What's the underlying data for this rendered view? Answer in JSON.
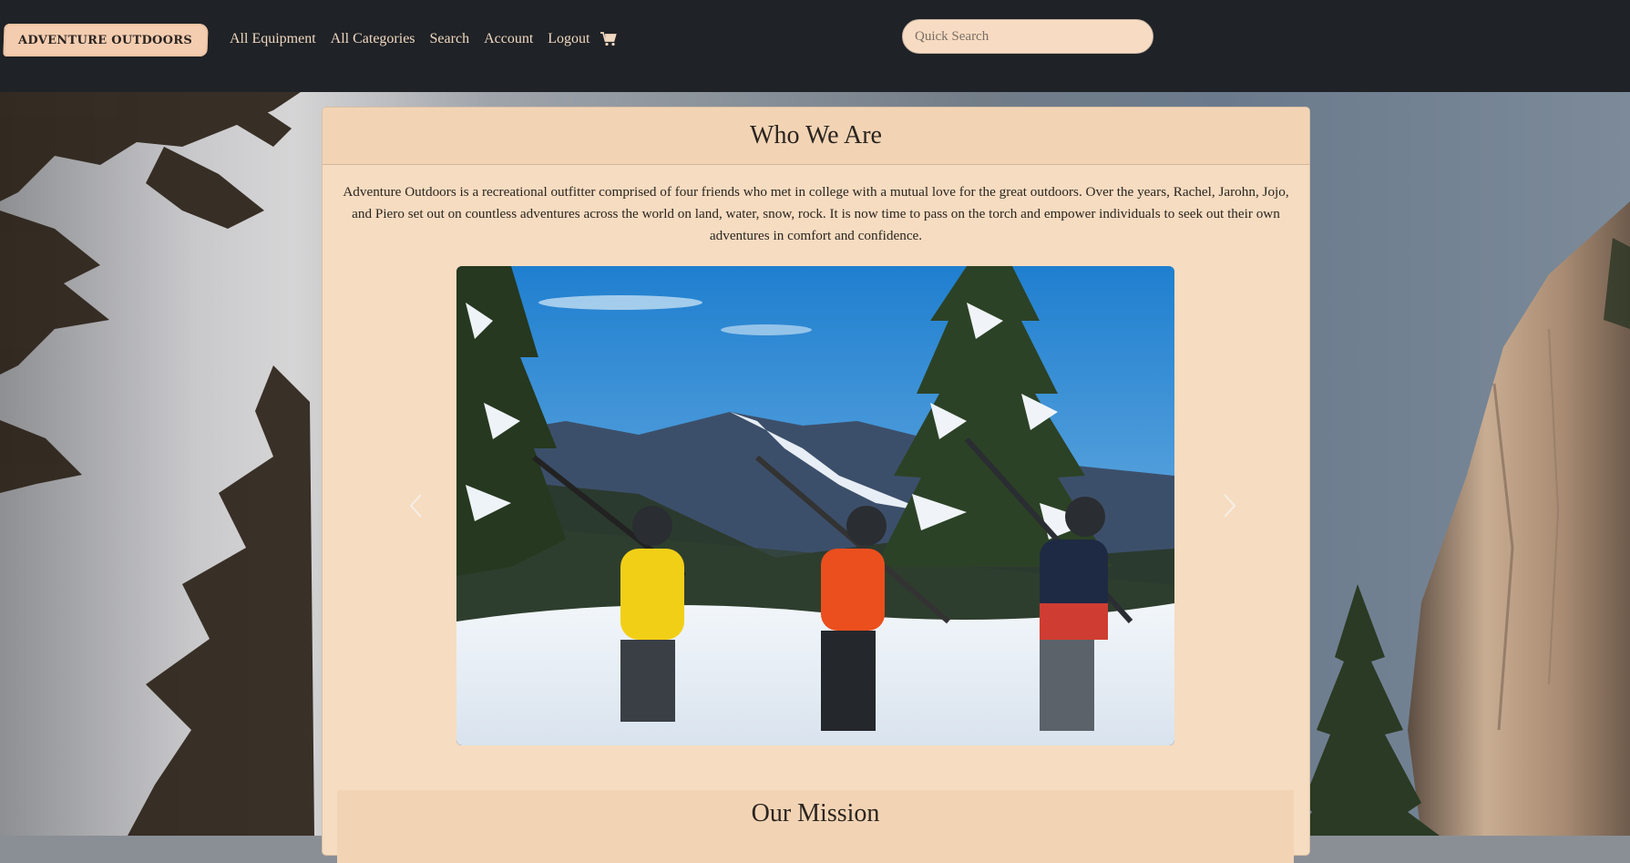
{
  "brand": "ADVENTURE OUTDOORS",
  "nav": {
    "links": [
      "All Equipment",
      "All Categories",
      "Search",
      "Account",
      "Logout"
    ],
    "cart_icon": "shopping-cart-icon"
  },
  "search": {
    "placeholder": "Quick Search",
    "value": ""
  },
  "about": {
    "title": "Who We Are",
    "text": "Adventure Outdoors is a recreational outfitter comprised of four friends who met in college with a mutual love for the great outdoors. Over the years, Rachel, Jarohn, Jojo, and Piero set out on countless adventures across the world on land, water, snow, rock. It is now time to pass on the torch and empower individuals to seek out their own adventures in comfort and confidence."
  },
  "carousel": {
    "prev_icon": "chevron-left-icon",
    "next_icon": "chevron-right-icon"
  },
  "mission": {
    "title": "Our Mission"
  },
  "colors": {
    "navbar": "#1f2226",
    "card": "#f6dcc1",
    "card_header": "#f2d4b5",
    "brand_badge": "#f4cdb0",
    "nav_link": "#efd7c0"
  }
}
